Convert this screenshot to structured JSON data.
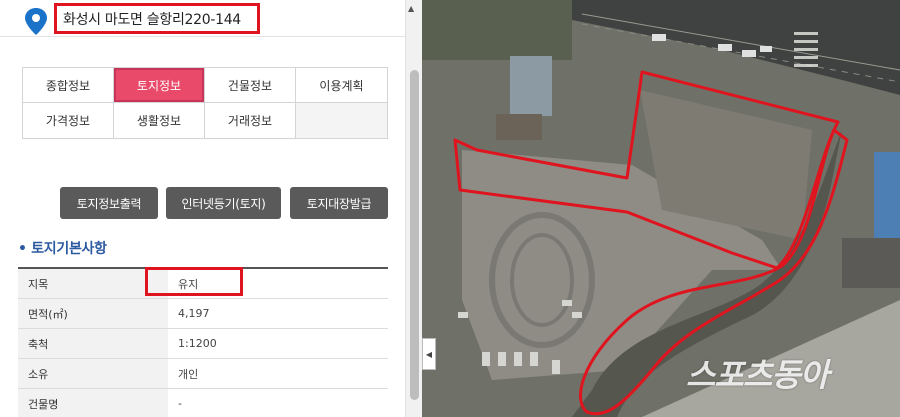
{
  "address": "화성시 마도면 슬항리220-144",
  "tabs": [
    {
      "label": "종합정보",
      "active": false
    },
    {
      "label": "토지정보",
      "active": true
    },
    {
      "label": "건물정보",
      "active": false
    },
    {
      "label": "이용계획",
      "active": false
    },
    {
      "label": "가격정보",
      "active": false
    },
    {
      "label": "생활정보",
      "active": false
    },
    {
      "label": "거래정보",
      "active": false
    },
    {
      "label": "",
      "active": false
    }
  ],
  "buttons": {
    "land_info_print": "토지정보출력",
    "internet_registry": "인터넷등기(토지)",
    "land_ledger_issue": "토지대장발급"
  },
  "section_title": "• 토지기본사항",
  "land_table": [
    {
      "key": "지목",
      "value": "유지"
    },
    {
      "key": "면적(㎡)",
      "value": "4,197"
    },
    {
      "key": "축척",
      "value": "1:1200"
    },
    {
      "key": "소유",
      "value": "개인"
    },
    {
      "key": "건물명",
      "value": "-"
    }
  ],
  "watermark": "스포츠동아",
  "colors": {
    "active_tab": "#ea4a6a",
    "highlight_red": "#e0141e",
    "button_gray": "#5a5a5a",
    "section_blue": "#2c5aa0",
    "pin_blue": "#1a73c8"
  },
  "icons": {
    "location": "location-pin-icon",
    "scroll_up": "chevron-up-icon",
    "collapse": "chevron-left-icon"
  }
}
